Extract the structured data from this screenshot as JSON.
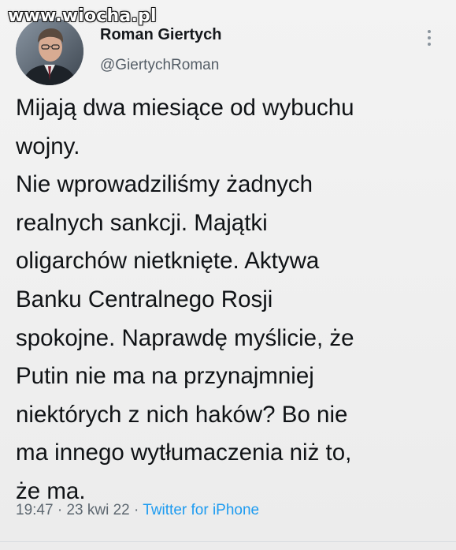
{
  "watermark": {
    "text": "www.wiocha.pl"
  },
  "author": {
    "name": "Roman Giertych",
    "handle": "@GiertychRoman"
  },
  "tweet": {
    "lines": [
      "Mijają dwa miesiące od wybuchu",
      "wojny.",
      "Nie wprowadziliśmy żadnych",
      "realnych sankcji. Majątki",
      "oligarchów nietknięte. Aktywa",
      "Banku Centralnego Rosji",
      "spokojne. Naprawdę myślicie, że",
      "Putin nie ma na przynajmniej",
      "niektórych z nich haków? Bo nie",
      "ma innego wytłumaczenia niż to,",
      "że ma."
    ]
  },
  "meta": {
    "time": "19:47",
    "date": "23 kwi 22",
    "separator": "·",
    "source": "Twitter for iPhone"
  },
  "icons": {
    "more_menu": "more-vertical-icon",
    "avatar": "profile-photo"
  },
  "colors": {
    "source_link": "#1d9bf0",
    "text": "#101316",
    "secondary": "#545d66"
  }
}
